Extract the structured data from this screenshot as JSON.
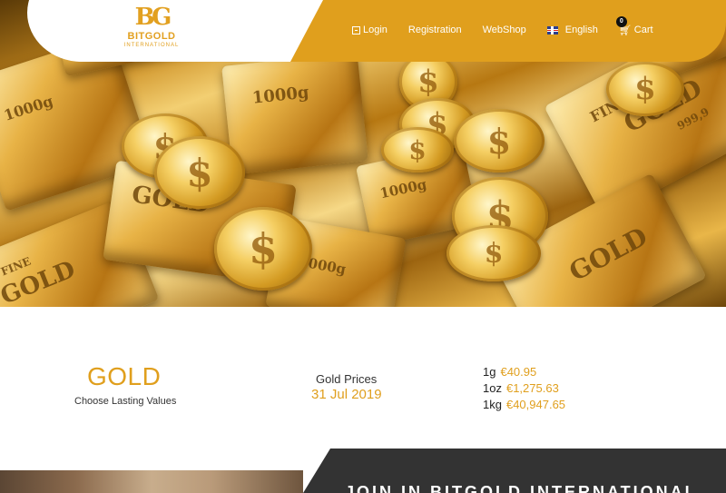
{
  "brand": {
    "mark": "BG",
    "name": "BITGOLD",
    "subtitle": "INTERNATIONAL"
  },
  "nav": {
    "login": "Login",
    "registration": "Registration",
    "webshop": "WebShop",
    "language": "English",
    "cart": "Cart",
    "cart_count": "0"
  },
  "hero": {
    "bar_stamp_weight": "1000g",
    "bar_stamp_fine": "FINE",
    "bar_stamp_gold": "GOLD",
    "bar_stamp_purity": "999,9",
    "coin_symbol": "$"
  },
  "section": {
    "title": "GOLD",
    "subtitle": "Choose Lasting Values",
    "prices_label": "Gold Prices",
    "prices_date": "31 Jul 2019",
    "prices": [
      {
        "unit": "1g",
        "value": "€40.95"
      },
      {
        "unit": "1oz",
        "value": "€1,275.63"
      },
      {
        "unit": "1kg",
        "value": "€40,947.65"
      }
    ]
  },
  "bottom": {
    "heading": "JOIN IN BITGOLD INTERNATIONAL"
  }
}
